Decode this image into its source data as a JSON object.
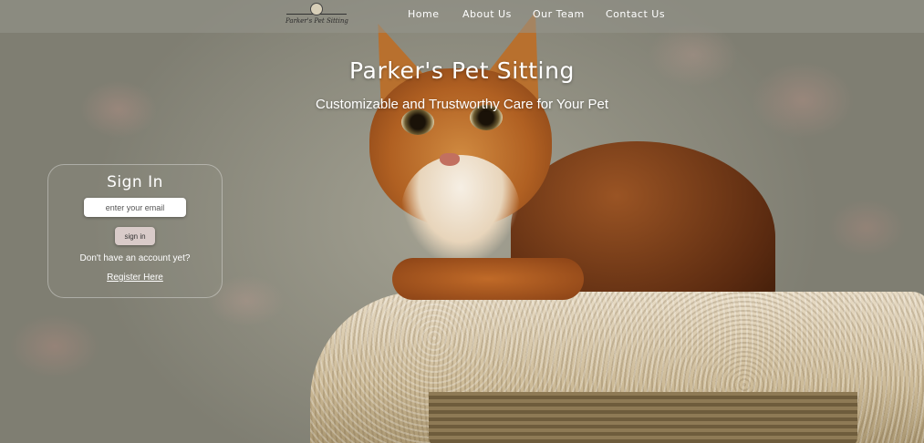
{
  "nav": {
    "logo_text": "Parker's Pet Sitting",
    "links": [
      {
        "label": "Home"
      },
      {
        "label": "About Us"
      },
      {
        "label": "Our Team"
      },
      {
        "label": "Contact Us"
      }
    ]
  },
  "hero": {
    "title": "Parker's Pet Sitting",
    "subtitle": "Customizable and Trustworthy Care for Your Pet"
  },
  "signin": {
    "title": "Sign In",
    "email_placeholder": "enter your email",
    "button_label": "sign in",
    "no_account_text": "Don't have an account yet?",
    "register_link": "Register Here"
  },
  "colors": {
    "text": "#ffffff",
    "button_bg": "#d9cbc9"
  }
}
